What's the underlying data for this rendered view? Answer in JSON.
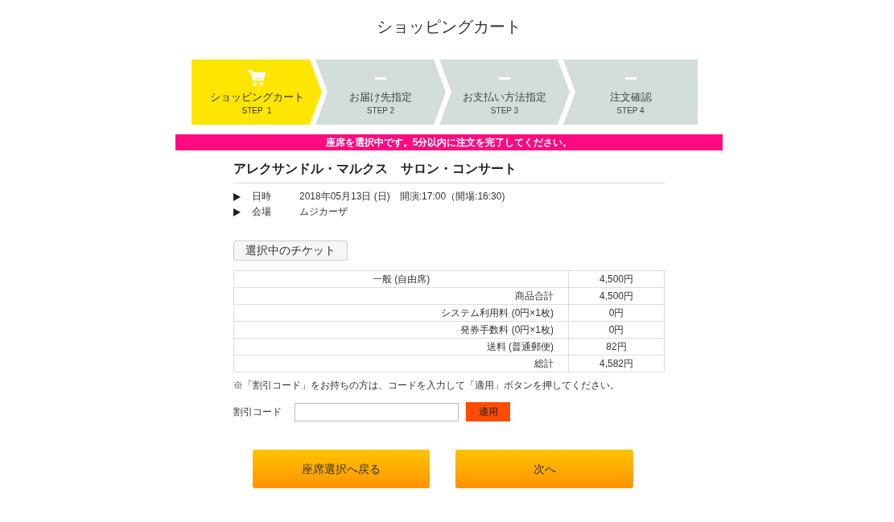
{
  "page_title": "ショッピングカート",
  "steps": [
    {
      "label": "ショッピングカート",
      "step": "STEP  1",
      "selected": true
    },
    {
      "label": "お届け先指定",
      "step": "STEP 2",
      "selected": false
    },
    {
      "label": "お支払い方法指定",
      "step": "STEP 3",
      "selected": false
    },
    {
      "label": "注文確認",
      "step": "STEP 4",
      "selected": false
    }
  ],
  "notice": "座席を選択中です。5分以内に注文を完了してください。",
  "event": {
    "title": "アレクサンドル・マルクス　サロン・コンサート",
    "details": [
      {
        "label": "日時",
        "value": "2018年05月13日 (日)　開演:17:00（開場:16:30)"
      },
      {
        "label": "会場",
        "value": "ムジカーザ"
      }
    ]
  },
  "tickets_heading": "選択中のチケット",
  "charges": [
    {
      "kind": "item",
      "label": "一般 (自由席)",
      "amount": "4,500円"
    },
    {
      "kind": "summary",
      "label": "商品合計",
      "amount": "4,500円"
    },
    {
      "kind": "summary",
      "label": "システム利用料 (0円×1枚)",
      "amount": "0円"
    },
    {
      "kind": "summary",
      "label": "発券手数料 (0円×1枚)",
      "amount": "0円"
    },
    {
      "kind": "summary",
      "label": "送料 (普通郵便)",
      "amount": "82円"
    },
    {
      "kind": "summary",
      "label": "総計",
      "amount": "4,582円"
    }
  ],
  "discount": {
    "note": "※「割引コード」をお持ちの方は、コードを入力して「適用」ボタンを押してください。",
    "label": "割引コード",
    "apply_button": "適用"
  },
  "buttons": [
    {
      "label": "座席選択へ戻る"
    },
    {
      "label": "次へ"
    }
  ]
}
